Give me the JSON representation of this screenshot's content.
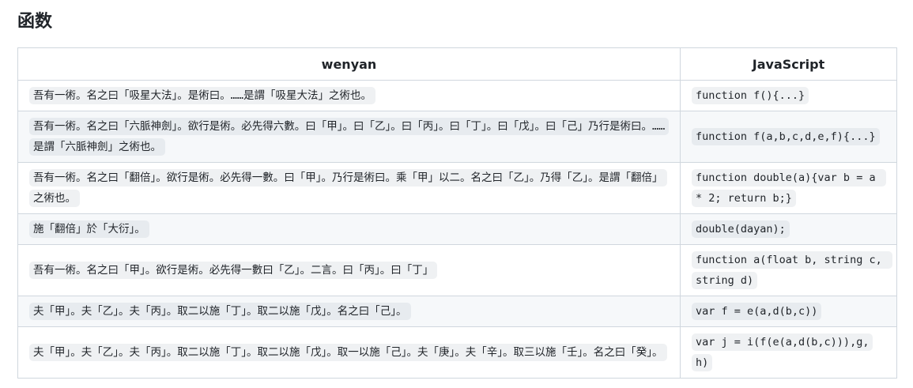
{
  "heading": "函数",
  "table": {
    "headers": [
      "wenyan",
      "JavaScript"
    ],
    "rows": [
      {
        "wenyan": "吾有一術。名之曰「吸星大法」。是術曰。……是謂「吸星大法」之術也。",
        "js": "function f(){...}"
      },
      {
        "wenyan": "吾有一術。名之曰「六脈神劍」。欲行是術。必先得六數。曰「甲」。曰「乙」。曰「丙」。曰「丁」。曰「戊」。曰「己」乃行是術曰。……是謂「六脈神劍」之術也。",
        "js": "function f(a,b,c,d,e,f){...}"
      },
      {
        "wenyan": "吾有一術。名之曰「翻倍」。欲行是術。必先得一數。曰「甲」。乃行是術曰。乘「甲」以二。名之曰「乙」。乃得「乙」。是謂「翻倍」之術也。",
        "js": "function double(a){var b = a * 2; return b;}"
      },
      {
        "wenyan": "施「翻倍」於「大衍」。",
        "js": "double(dayan);"
      },
      {
        "wenyan": "吾有一術。名之曰「甲」。欲行是術。必先得一數曰「乙」。二言。曰「丙」。曰「丁」",
        "js": "function a(float b, string c, string d)"
      },
      {
        "wenyan": "夫「甲」。夫「乙」。夫「丙」。取二以施「丁」。取二以施「戊」。名之曰「己」。",
        "js": "var f = e(a,d(b,c))"
      },
      {
        "wenyan": "夫「甲」。夫「乙」。夫「丙」。取二以施「丁」。取二以施「戊」。取一以施「己」。夫「庚」。夫「辛」。取三以施「壬」。名之曰「癸」。",
        "js": "var j = i(f(e(a,d(b,c))),g,h)"
      }
    ]
  }
}
